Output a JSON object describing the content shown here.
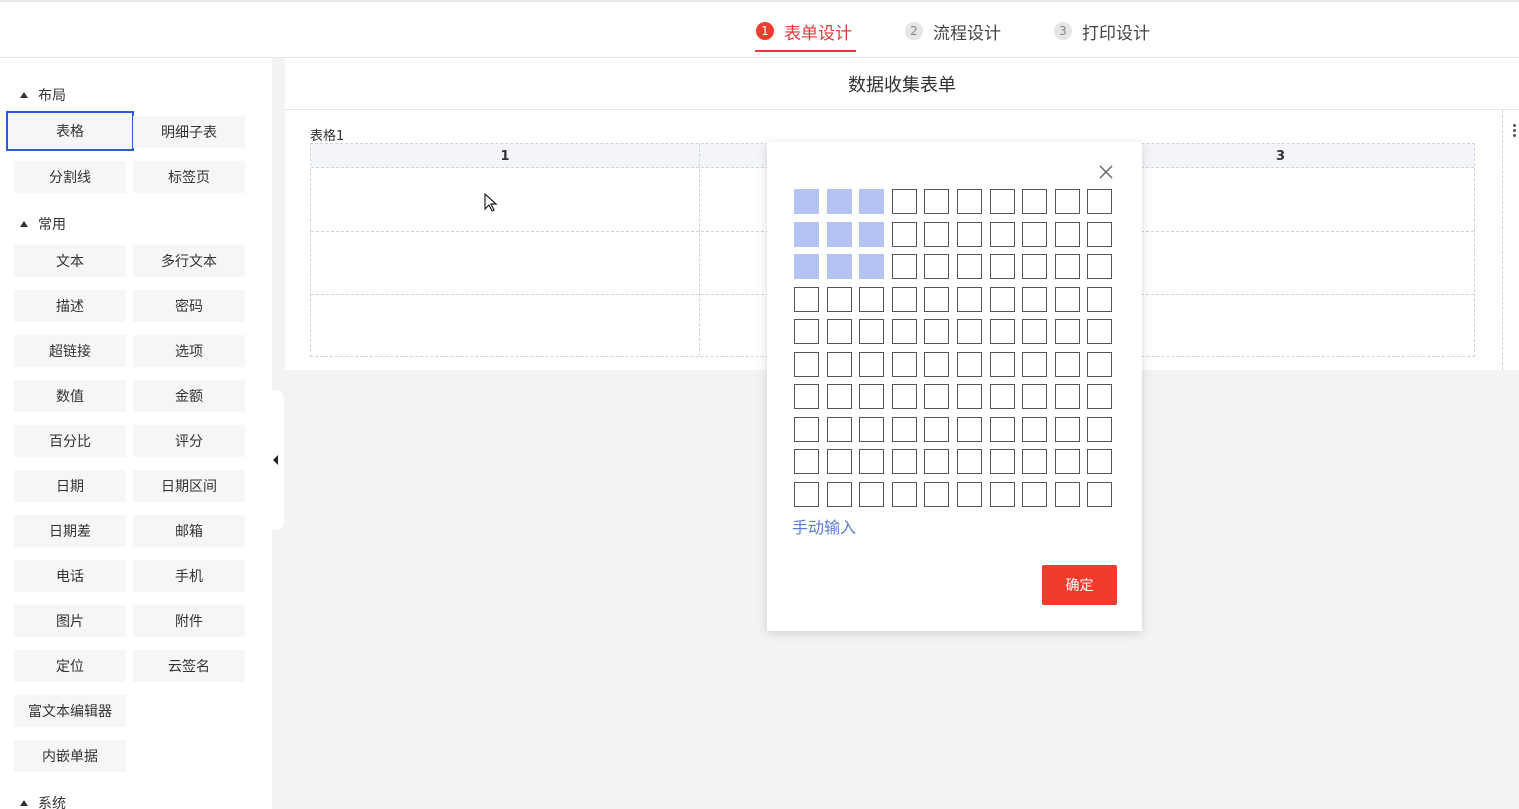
{
  "steps": [
    {
      "num": "1",
      "label": "表单设计"
    },
    {
      "num": "2",
      "label": "流程设计"
    },
    {
      "num": "3",
      "label": "打印设计"
    }
  ],
  "sidebar": {
    "sections": [
      {
        "title": "布局",
        "items": [
          "表格",
          "明细子表",
          "分割线",
          "标签页"
        ]
      },
      {
        "title": "常用",
        "items": [
          "文本",
          "多行文本",
          "描述",
          "密码",
          "超链接",
          "选项",
          "数值",
          "金额",
          "百分比",
          "评分",
          "日期",
          "日期区间",
          "日期差",
          "邮箱",
          "电话",
          "手机",
          "图片",
          "附件",
          "定位",
          "云签名",
          "富文本编辑器",
          "内嵌单据"
        ]
      },
      {
        "title": "系统",
        "items": []
      }
    ],
    "selected_item": "表格"
  },
  "canvas": {
    "form_title": "数据收集表单",
    "table_label": "表格1",
    "columns": [
      "1",
      "",
      "3"
    ]
  },
  "popup": {
    "grid_rows": 10,
    "grid_cols": 10,
    "selected_rows": 3,
    "selected_cols": 3,
    "manual_input_label": "手动输入",
    "confirm_label": "确定"
  },
  "colors": {
    "accent": "#f03c2d",
    "selection_fill": "#b5c3f3",
    "selected_border": "#2b5cd8",
    "link": "#5b7bd6"
  }
}
